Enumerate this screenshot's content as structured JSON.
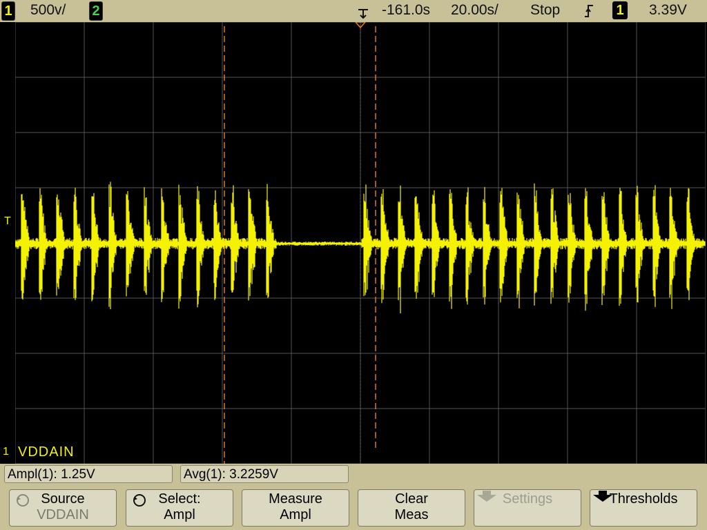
{
  "status": {
    "ch1_num": "1",
    "ch1_scale": "500v/",
    "ch2_num": "2",
    "trig_offset": "-161.0s",
    "timebase": "20.00s/",
    "run_state": "Stop",
    "trig_slope_icon": "rising-edge-icon",
    "trig_source": "1",
    "trig_level": "3.39V"
  },
  "labels": {
    "trace_label": "VDDAIN",
    "ground_marker": "1",
    "trigger_marker": "T"
  },
  "measurements": [
    {
      "text": "Ampl(1): 1.25V"
    },
    {
      "text": "Avg(1): 3.2259V"
    }
  ],
  "softkeys": [
    {
      "line1": "Source",
      "line2": "VDDAIN",
      "icon": "rotary-knob-icon",
      "enabled": true
    },
    {
      "line1": "Select:",
      "line2": "Ampl",
      "icon": "rotary-knob-icon",
      "enabled": true
    },
    {
      "line1": "Measure",
      "line2": "Ampl",
      "enabled": true
    },
    {
      "line1": "Clear",
      "line2": "Meas",
      "enabled": true
    },
    {
      "line1": "Settings",
      "line2": "",
      "icon": "down-arrow-icon",
      "enabled": false
    },
    {
      "line1": "Thresholds",
      "line2": "",
      "icon": "down-arrow-icon",
      "enabled": true
    }
  ],
  "colors": {
    "trace": "#f4f200",
    "cursor": "#e8802a",
    "grid": "#555555",
    "bezel": "#c8c097"
  }
}
